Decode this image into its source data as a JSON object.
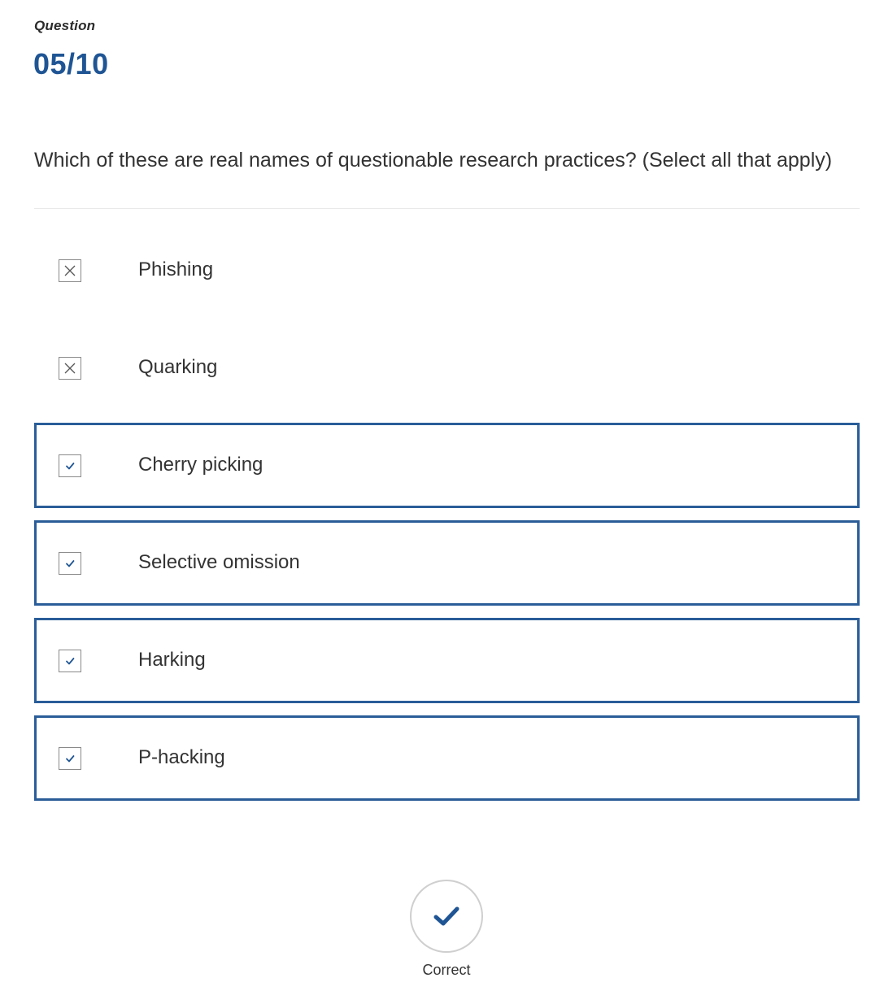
{
  "header": {
    "label": "Question",
    "counter": "05/10"
  },
  "question": {
    "text": "Which of these are real names of questionable research practices? (Select all that apply)"
  },
  "options": [
    {
      "label": "Phishing",
      "selected": false,
      "mark": "cross-icon"
    },
    {
      "label": "Quarking",
      "selected": false,
      "mark": "cross-icon"
    },
    {
      "label": "Cherry picking",
      "selected": true,
      "mark": "checkmark-icon"
    },
    {
      "label": "Selective omission",
      "selected": true,
      "mark": "checkmark-icon"
    },
    {
      "label": "Harking",
      "selected": true,
      "mark": "checkmark-icon"
    },
    {
      "label": "P-hacking",
      "selected": true,
      "mark": "checkmark-icon"
    }
  ],
  "result": {
    "icon": "checkmark-icon",
    "label": "Correct"
  },
  "colors": {
    "accent": "#1f5594",
    "selected_border": "#2a5d98",
    "divider": "#e9e9e9"
  }
}
